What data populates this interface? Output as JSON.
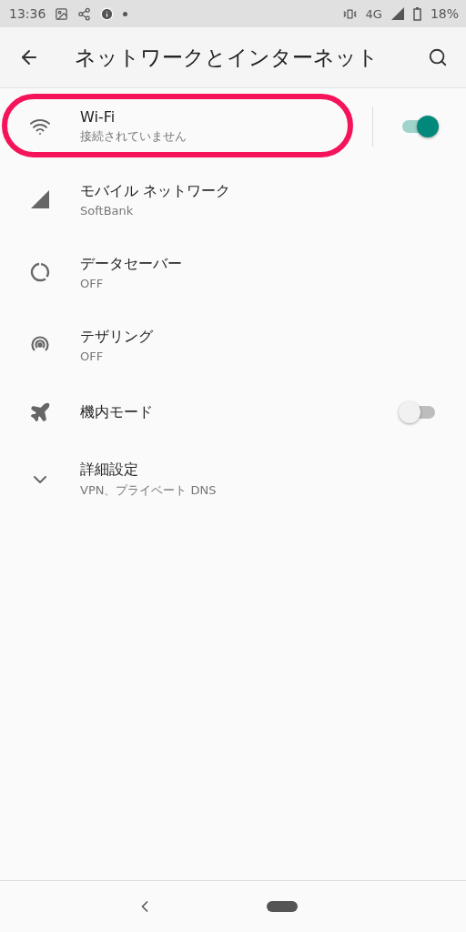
{
  "status_bar": {
    "time": "13:36",
    "network": "4G",
    "battery": "18%"
  },
  "toolbar": {
    "title": "ネットワークとインターネット"
  },
  "items": [
    {
      "kind": "toggle",
      "title": "Wi-Fi",
      "subtitle": "接続されていません",
      "on": true,
      "divider": true,
      "highlighted": true
    },
    {
      "kind": "plain",
      "title": "モバイル ネットワーク",
      "subtitle": "SoftBank"
    },
    {
      "kind": "plain",
      "title": "データセーバー",
      "subtitle": "OFF"
    },
    {
      "kind": "plain",
      "title": "テザリング",
      "subtitle": "OFF"
    },
    {
      "kind": "toggle",
      "title": "機内モード",
      "on": false,
      "divider": false,
      "highlighted": false
    },
    {
      "kind": "plain",
      "title": "詳細設定",
      "subtitle": "VPN、プライベート DNS"
    }
  ]
}
